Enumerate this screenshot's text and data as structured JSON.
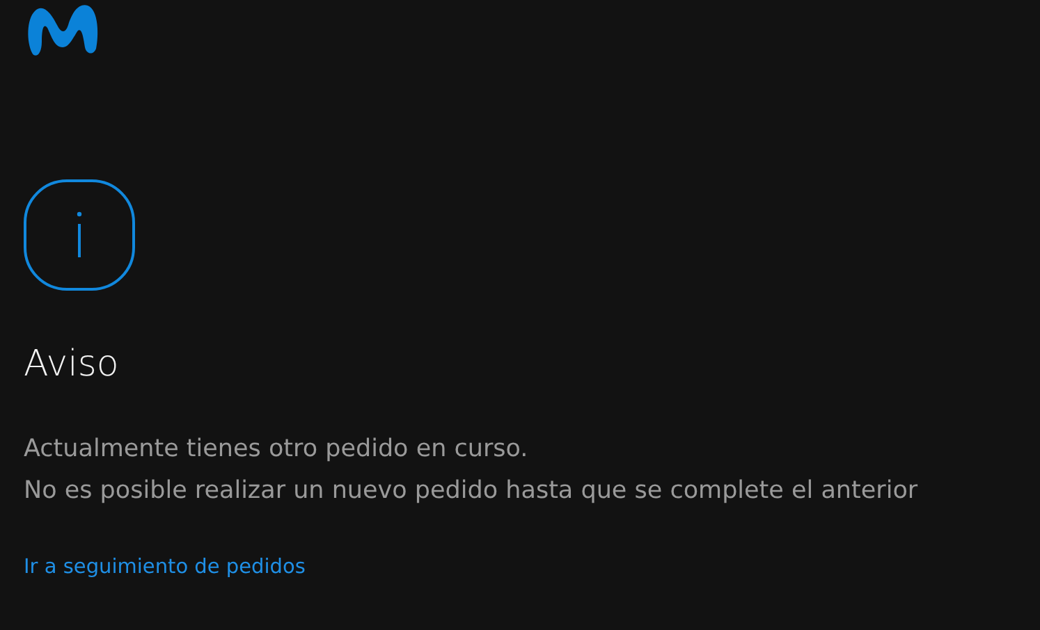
{
  "title": "Aviso",
  "message": [
    "Actualmente tienes otro pedido en curso.",
    "No es posible realizar un nuevo pedido hasta que se complete el anterior"
  ],
  "link": "Ir a seguimiento de pedidos"
}
